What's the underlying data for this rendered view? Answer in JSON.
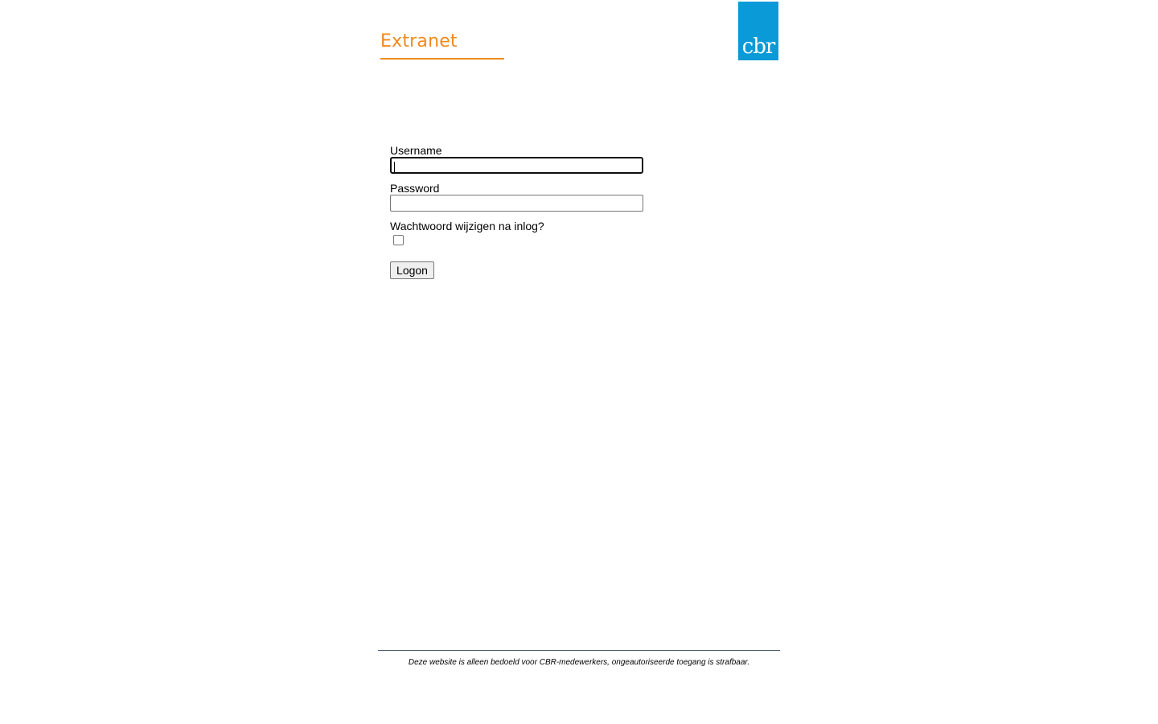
{
  "header": {
    "title": "Extranet",
    "accent_color": "#f08a1c",
    "logo": {
      "text": "cbr",
      "background_color": "#0a9ad7",
      "text_color": "#ffffff"
    }
  },
  "form": {
    "username": {
      "label": "Username",
      "value": "",
      "focused": true
    },
    "password": {
      "label": "Password",
      "value": ""
    },
    "change_password": {
      "label": "Wachtwoord wijzigen na inlog?",
      "checked": false
    },
    "submit_label": "Logon"
  },
  "footer": {
    "notice": "Deze website is alleen bedoeld voor CBR-medewerkers, ongeautoriseerde toegang is strafbaar."
  }
}
